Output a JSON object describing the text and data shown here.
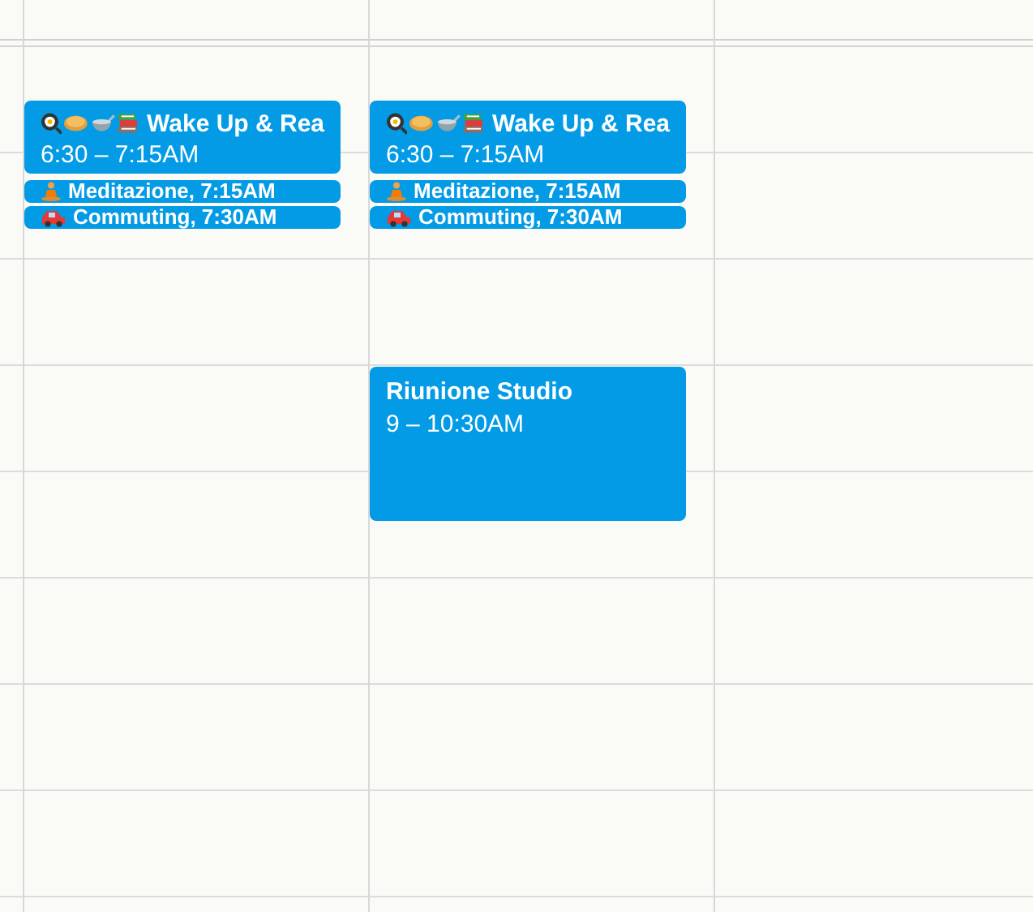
{
  "columns": [
    {
      "events": [
        {
          "kind": "wake",
          "title": "Wake Up & Rea",
          "time": "6:30 – 7:15AM"
        },
        {
          "kind": "meditation",
          "title": "Meditazione, 7:15AM"
        },
        {
          "kind": "commute",
          "title": "Commuting, 7:30AM"
        }
      ]
    },
    {
      "events": [
        {
          "kind": "wake",
          "title": "Wake Up & Rea",
          "time": "6:30 – 7:15AM"
        },
        {
          "kind": "meditation",
          "title": "Meditazione, 7:15AM"
        },
        {
          "kind": "commute",
          "title": "Commuting, 7:30AM"
        },
        {
          "kind": "meeting",
          "title": "Riunione Studio",
          "time": "9 – 10:30AM"
        }
      ]
    },
    {}
  ]
}
